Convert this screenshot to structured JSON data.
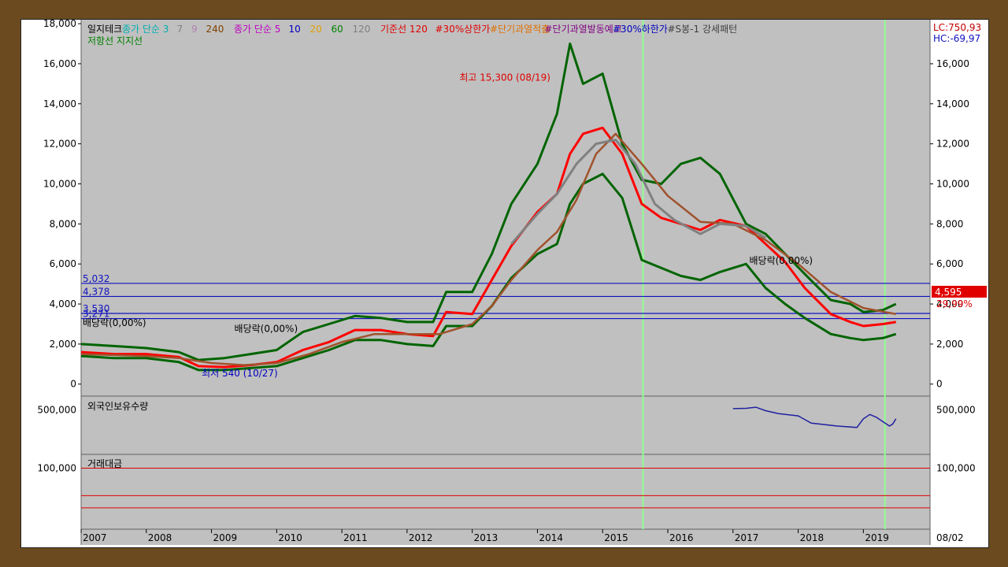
{
  "chart_data": {
    "type": "line",
    "title": "일지테크",
    "legend_items": [
      {
        "text": "일지테크",
        "color": "#000000"
      },
      {
        "text": "종가 단순 3",
        "color": "#00b0b0"
      },
      {
        "text": "7",
        "color": "#808080"
      },
      {
        "text": "9",
        "color": "#b080b0"
      },
      {
        "text": "240",
        "color": "#804000"
      },
      {
        "text": "종가 단순 5",
        "color": "#c000c0"
      },
      {
        "text": "10",
        "color": "#0000c0"
      },
      {
        "text": "20",
        "color": "#e0a000"
      },
      {
        "text": "60",
        "color": "#008000"
      },
      {
        "text": "120",
        "color": "#808080"
      },
      {
        "text": "기준선 120",
        "color": "#e00000"
      },
      {
        "text": "#30%상한가",
        "color": "#e00000"
      },
      {
        "text": "#단기과열적출",
        "color": "#e07000"
      },
      {
        "text": "#단기과열발동예고",
        "color": "#800080"
      },
      {
        "text": "#30%하한가",
        "color": "#0000c0"
      },
      {
        "text": "#S봉-1 강세패턴",
        "color": "#404040"
      }
    ],
    "legend_line2": "저항선 지지선",
    "right_info": {
      "lc": "LC:750,93",
      "hc": "HC:-69,97"
    },
    "price_label": "4,595",
    "pct_label": "29,99%",
    "y_ticks_left": [
      "18,000",
      "16,000",
      "14,000",
      "12,000",
      "10,000",
      "8,000",
      "6,000",
      "4,000",
      "2,000",
      "0"
    ],
    "y_ticks_right": [
      "16,000",
      "14,000",
      "12,000",
      "10,000",
      "8,000",
      "6,000",
      "4,000",
      "2,000",
      "0"
    ],
    "ylim": [
      -600,
      18200
    ],
    "x_labels": [
      "2007",
      "2008",
      "2009",
      "2010",
      "2011",
      "2012",
      "2013",
      "2014",
      "2015",
      "2016",
      "2017",
      "2018",
      "2019",
      "08/02"
    ],
    "xlim": [
      2007.0,
      2019.95
    ],
    "h_lines": [
      {
        "label": "5,032",
        "value": 5032
      },
      {
        "label": "4,378",
        "value": 4378
      },
      {
        "label": "3,530",
        "value": 3530
      },
      {
        "label": "3,271",
        "value": 3271
      }
    ],
    "annotations": [
      {
        "text": "최고 15,300 (08/19)",
        "color": "#e00000"
      },
      {
        "text": "최저 540 (10/27)",
        "color": "#0000c0"
      },
      {
        "text": "배당락(0,00%)",
        "color": "#000000"
      },
      {
        "text": "배당락(0,00%)",
        "color": "#000000"
      },
      {
        "text": "배당락(0,00%)",
        "color": "#000000"
      }
    ],
    "series": [
      {
        "color": "#ff0000",
        "x": [
          2007.0,
          2007.5,
          2008.0,
          2008.5,
          2008.8,
          2009.2,
          2009.6,
          2010.0,
          2010.4,
          2010.8,
          2011.2,
          2011.6,
          2012.0,
          2012.4,
          2012.6,
          2013.0,
          2013.3,
          2013.6,
          2014.0,
          2014.3,
          2014.5,
          2014.7,
          2015.0,
          2015.3,
          2015.6,
          2015.9,
          2016.2,
          2016.5,
          2016.8,
          2017.2,
          2017.5,
          2017.8,
          2018.1,
          2018.5,
          2018.8,
          2019.0,
          2019.3,
          2019.5
        ],
        "values": [
          1600,
          1500,
          1500,
          1350,
          900,
          850,
          950,
          1100,
          1700,
          2100,
          2700,
          2700,
          2500,
          2400,
          3600,
          3500,
          5200,
          6900,
          8600,
          9500,
          11500,
          12500,
          12800,
          11500,
          9000,
          8300,
          8000,
          7700,
          8200,
          7900,
          7000,
          6100,
          4800,
          3500,
          3100,
          2900,
          3000,
          3100
        ]
      },
      {
        "color": "#006400",
        "x": [
          2007.0,
          2007.5,
          2008.0,
          2008.5,
          2008.8,
          2009.2,
          2009.6,
          2010.0,
          2010.4,
          2010.8,
          2011.2,
          2011.6,
          2012.0,
          2012.4,
          2012.6,
          2013.0,
          2013.3,
          2013.6,
          2014.0,
          2014.3,
          2014.5,
          2014.7,
          2015.0,
          2015.3,
          2015.6,
          2015.9,
          2016.2,
          2016.5,
          2016.8,
          2017.2,
          2017.5,
          2017.8,
          2018.1,
          2018.5,
          2018.8,
          2019.0,
          2019.3,
          2019.5
        ],
        "values": [
          2000,
          1900,
          1800,
          1600,
          1200,
          1300,
          1500,
          1700,
          2600,
          3000,
          3400,
          3300,
          3100,
          3100,
          4600,
          4600,
          6500,
          9000,
          11000,
          13500,
          17000,
          15000,
          15500,
          12000,
          10200,
          10000,
          11000,
          11300,
          10500,
          8000,
          7500,
          6500,
          5500,
          4200,
          4000,
          3600,
          3700,
          4000
        ]
      },
      {
        "color": "#006400",
        "x": [
          2007.0,
          2007.5,
          2008.0,
          2008.5,
          2008.8,
          2009.2,
          2009.6,
          2010.0,
          2010.4,
          2010.8,
          2011.2,
          2011.6,
          2012.0,
          2012.4,
          2012.6,
          2013.0,
          2013.3,
          2013.6,
          2014.0,
          2014.3,
          2014.5,
          2014.7,
          2015.0,
          2015.3,
          2015.6,
          2015.9,
          2016.2,
          2016.5,
          2016.8,
          2017.2,
          2017.5,
          2017.8,
          2018.1,
          2018.5,
          2018.8,
          2019.0,
          2019.3,
          2019.5
        ],
        "values": [
          1400,
          1300,
          1300,
          1100,
          700,
          700,
          800,
          900,
          1300,
          1700,
          2200,
          2200,
          2000,
          1900,
          2900,
          2900,
          3900,
          5300,
          6500,
          7000,
          9000,
          10000,
          10500,
          9300,
          6200,
          5800,
          5400,
          5200,
          5600,
          6000,
          4800,
          4000,
          3300,
          2500,
          2300,
          2200,
          2300,
          2500
        ]
      },
      {
        "color": "#a0522d",
        "x": [
          2007.0,
          2007.5,
          2008.0,
          2008.5,
          2009.0,
          2009.5,
          2010.0,
          2010.5,
          2011.0,
          2011.5,
          2012.0,
          2012.5,
          2013.0,
          2013.3,
          2013.6,
          2014.0,
          2014.3,
          2014.6,
          2014.9,
          2015.2,
          2015.6,
          2016.0,
          2016.5,
          2017.0,
          2017.5,
          2018.0,
          2018.5,
          2019.0,
          2019.5
        ],
        "values": [
          1500,
          1450,
          1400,
          1300,
          1050,
          950,
          1050,
          1500,
          2100,
          2500,
          2500,
          2500,
          3000,
          3900,
          5200,
          6700,
          7600,
          9200,
          11500,
          12500,
          11000,
          9400,
          8100,
          8000,
          7200,
          6000,
          4600,
          3800,
          3500
        ]
      },
      {
        "color": "#808080",
        "x": [
          2013.6,
          2014.0,
          2014.3,
          2014.6,
          2014.9,
          2015.2,
          2015.5,
          2015.8,
          2016.1,
          2016.5,
          2016.8,
          2017.2,
          2017.5
        ],
        "values": [
          7000,
          8500,
          9500,
          11000,
          12000,
          12200,
          11000,
          9000,
          8200,
          7500,
          8000,
          7900,
          7300
        ]
      }
    ],
    "panel_foreign": {
      "title": "외국인보유수량",
      "y_tick": "500,000",
      "ylim": [
        350000,
        540000
      ],
      "x": [
        2017.0,
        2017.2,
        2017.35,
        2017.5,
        2017.7,
        2018.0,
        2018.2,
        2018.6,
        2018.9,
        2019.0,
        2019.1,
        2019.2,
        2019.3,
        2019.4,
        2019.45,
        2019.5
      ],
      "values": [
        505000,
        506000,
        510000,
        498000,
        488000,
        480000,
        455000,
        445000,
        440000,
        470000,
        485000,
        475000,
        460000,
        445000,
        452000,
        470000
      ]
    },
    "panel_volume": {
      "title": "거래대금",
      "y_tick": "100,000",
      "ylim": [
        0,
        120000
      ],
      "ref_lines": [
        100000,
        55000,
        35000
      ]
    },
    "markers_vertical_years": [
      2015.62,
      2019.33
    ]
  }
}
